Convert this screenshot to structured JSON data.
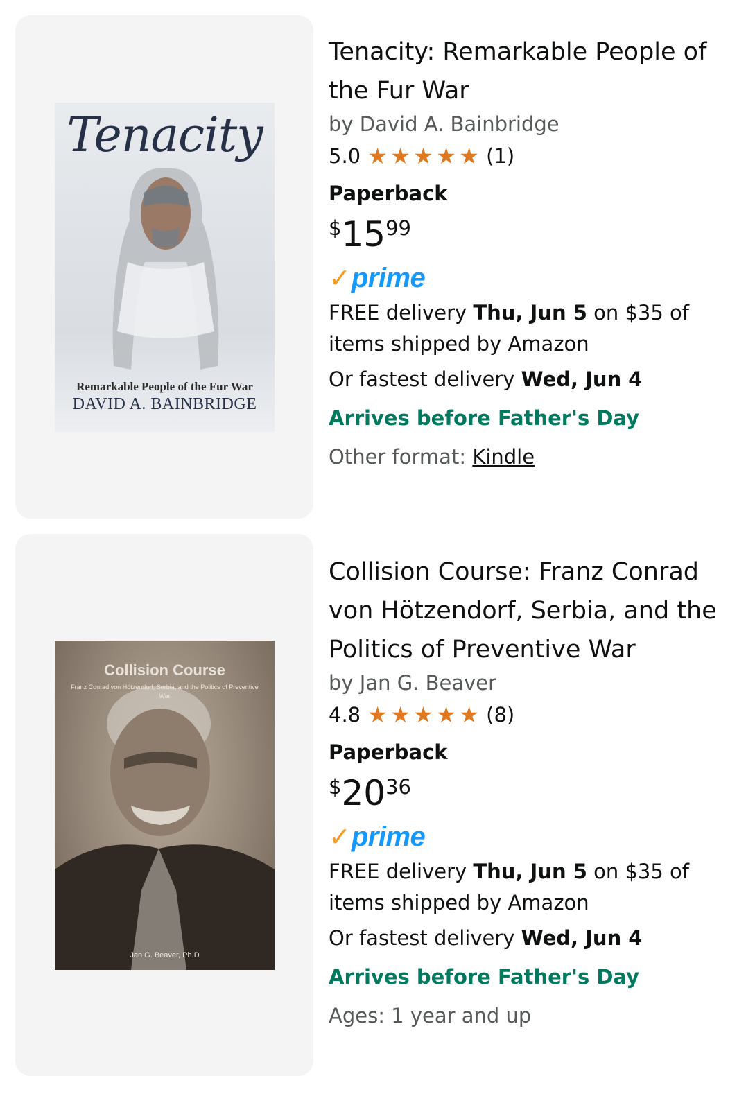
{
  "results": [
    {
      "cover": {
        "title": "Tenacity",
        "subtitle": "Remarkable People of the Fur War",
        "author": "DAVID A. BAINBRIDGE"
      },
      "title": "Tenacity: Remarkable People of the Fur War",
      "byline": "by David A. Bainbridge",
      "rating": "5.0",
      "stars": 5,
      "rating_count": "(1)",
      "format": "Paperback",
      "price": {
        "symbol": "$",
        "whole": "15",
        "fraction": "99"
      },
      "prime": {
        "check": "✓",
        "word": "prime"
      },
      "delivery": {
        "prefix": "FREE delivery ",
        "date": "Thu, Jun 5",
        "suffix": " on $35 of items shipped by Amazon"
      },
      "fastest": {
        "prefix": "Or fastest delivery ",
        "date": "Wed, Jun 4"
      },
      "arrives": "Arrives before Father's Day",
      "extra": {
        "label": "Other format: ",
        "link": "Kindle"
      }
    },
    {
      "cover": {
        "title": "Collision Course",
        "subtitle": "Franz Conrad von Hötzendorf, Serbia, and the Politics of Preventive War",
        "author": "Jan G. Beaver, Ph.D"
      },
      "title": "Collision Course: Franz Conrad von Hötzendorf, Serbia, and the Politics of Preventive War",
      "byline": "by Jan G. Beaver",
      "rating": "4.8",
      "stars": 5,
      "rating_count": "(8)",
      "format": "Paperback",
      "price": {
        "symbol": "$",
        "whole": "20",
        "fraction": "36"
      },
      "prime": {
        "check": "✓",
        "word": "prime"
      },
      "delivery": {
        "prefix": "FREE delivery ",
        "date": "Thu, Jun 5",
        "suffix": " on $35 of items shipped by Amazon"
      },
      "fastest": {
        "prefix": "Or fastest delivery ",
        "date": "Wed, Jun 4"
      },
      "arrives": "Arrives before Father's Day",
      "extra": {
        "label": "Ages: 1 year and up"
      }
    }
  ],
  "star_glyph": "★",
  "colors": {
    "star": "#de7921",
    "prime_blue": "#1399ff",
    "prime_check": "#f8991d",
    "arrives_green": "#007a5e",
    "muted": "#565959"
  }
}
